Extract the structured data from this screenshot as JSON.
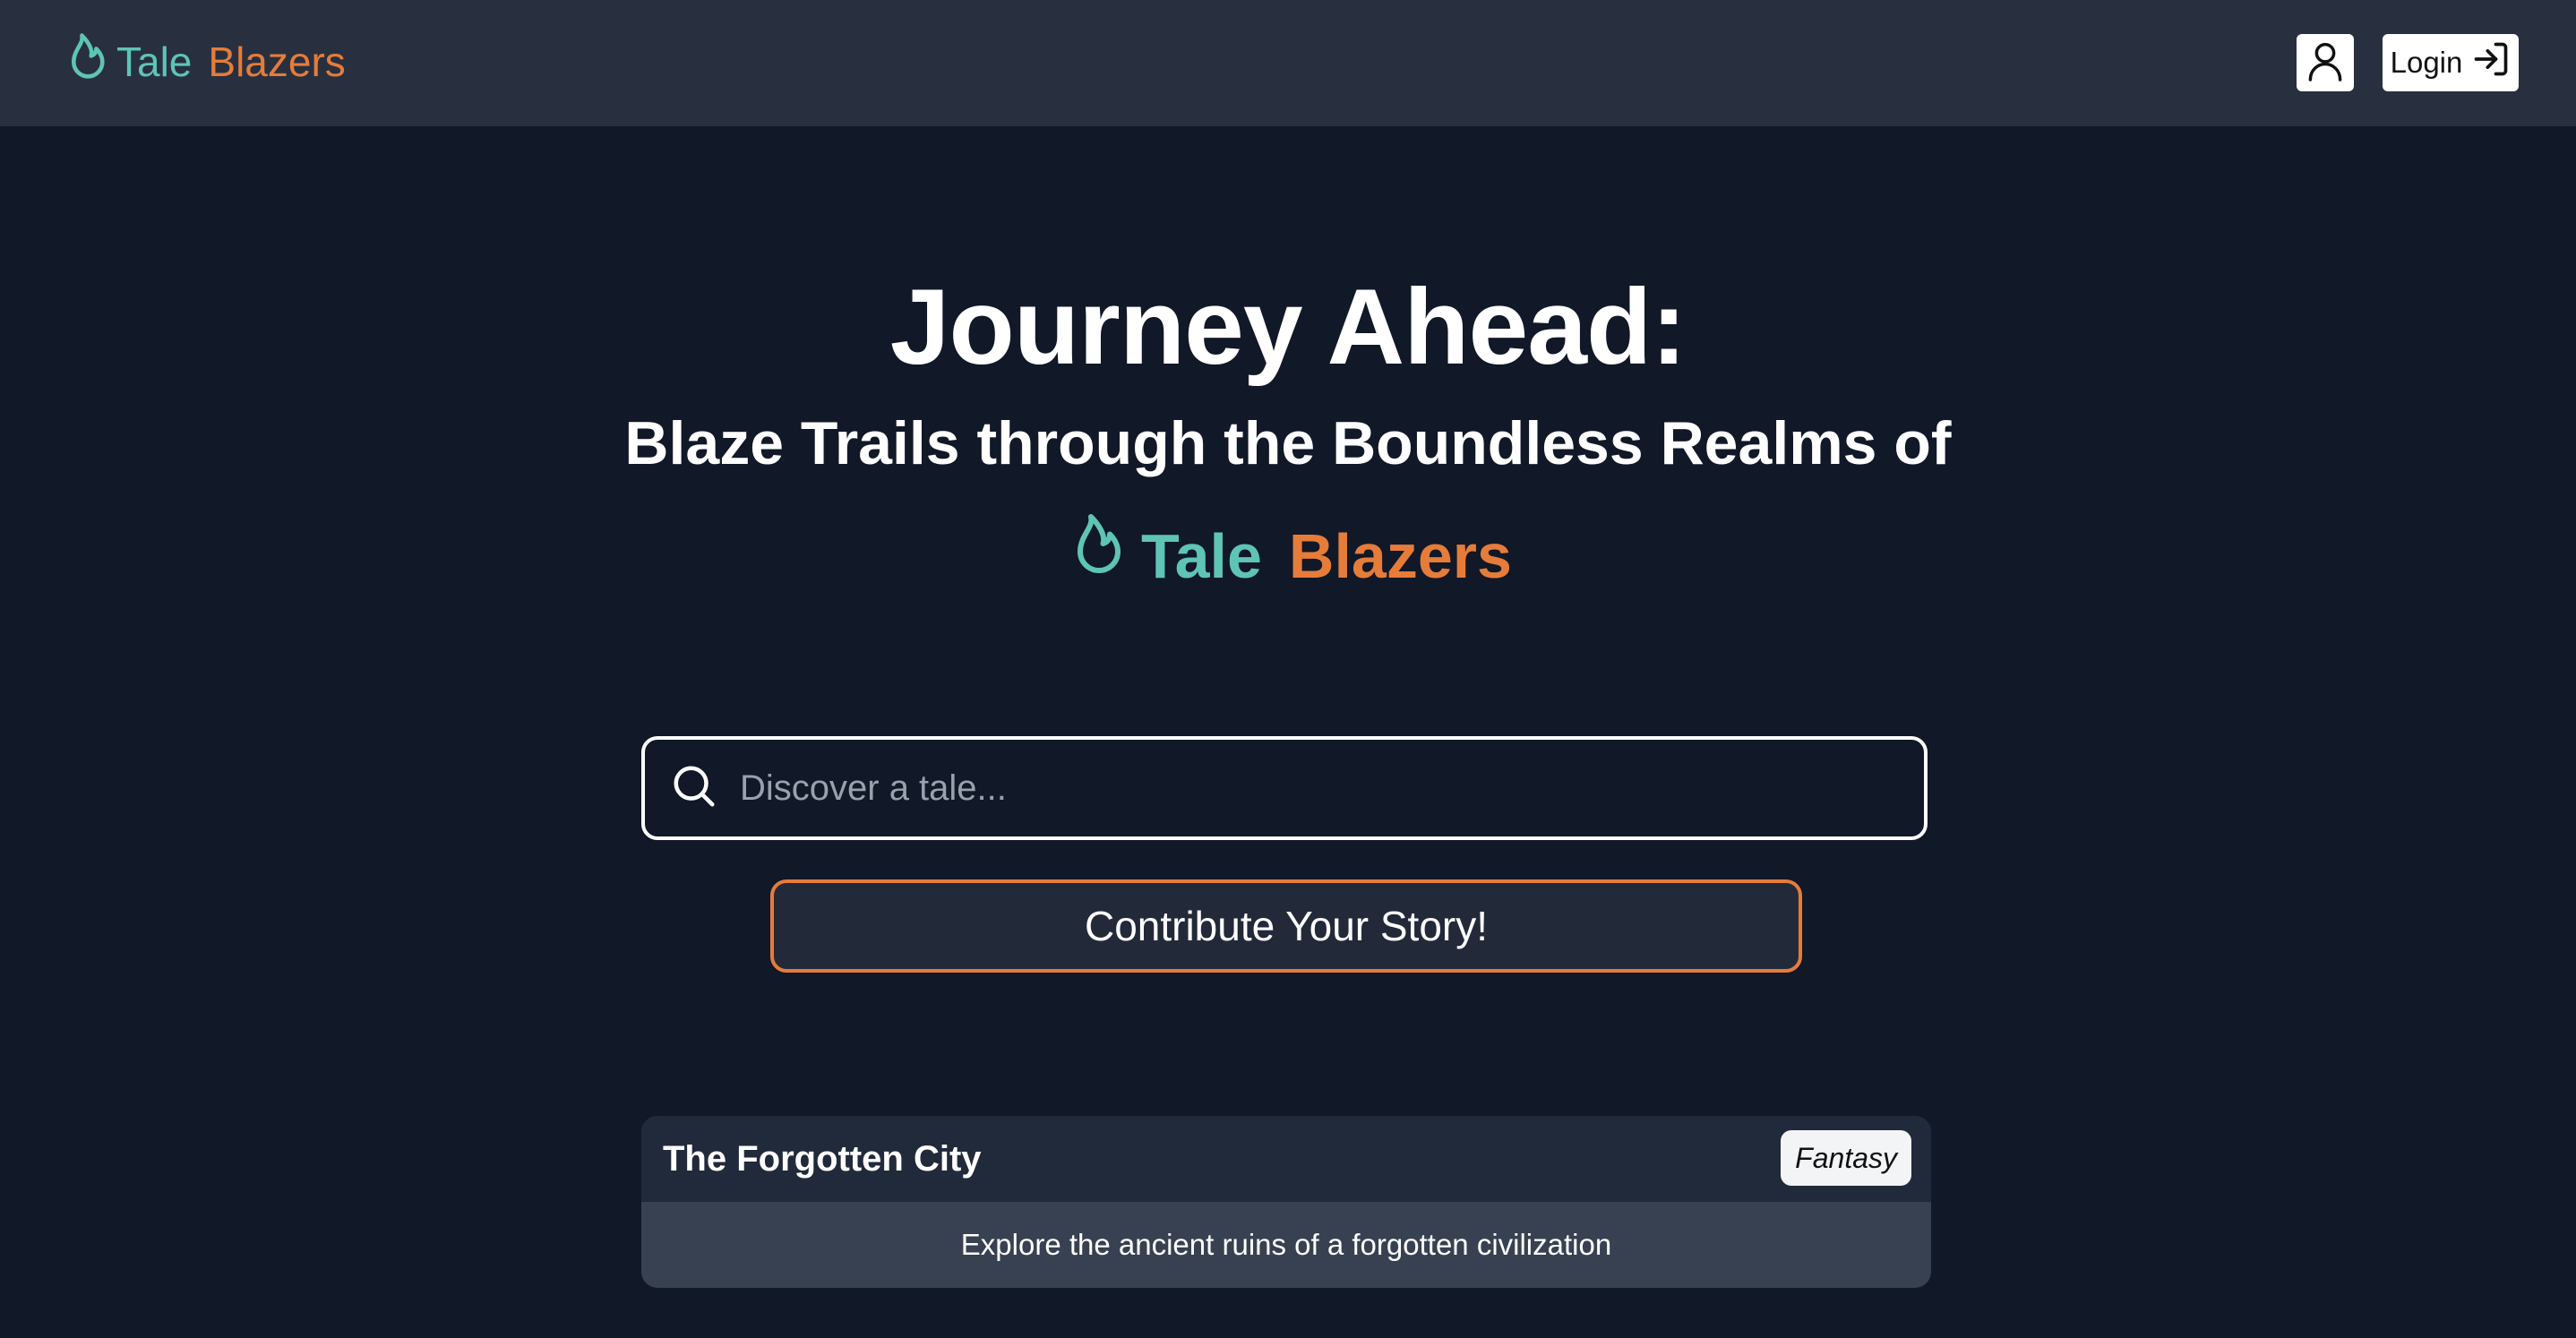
{
  "nav": {
    "brand_part1": "Tale",
    "brand_part2": "Blazers",
    "login_label": "Login",
    "profile_icon": "user-icon",
    "login_icon": "login-arrow-icon"
  },
  "hero": {
    "title": "Journey Ahead:",
    "subtitle": "Blaze Trails through the Boundless Realms of",
    "brand_part1": "Tale",
    "brand_part2": "Blazers",
    "brand_icon": "flame-icon"
  },
  "search": {
    "placeholder": "Discover a tale...",
    "value": "",
    "icon": "search-icon"
  },
  "contribute": {
    "label": "Contribute Your Story!"
  },
  "stories": [
    {
      "title": "The Forgotten City",
      "genre": "Fantasy",
      "description": "Explore the ancient ruins of a forgotten civilization"
    }
  ],
  "colors": {
    "background": "#111827",
    "navbar": "#283040",
    "brand_teal": "#5ec4b6",
    "brand_orange": "#e57c3a",
    "card_header": "#212a3a",
    "card_body": "#374151"
  }
}
